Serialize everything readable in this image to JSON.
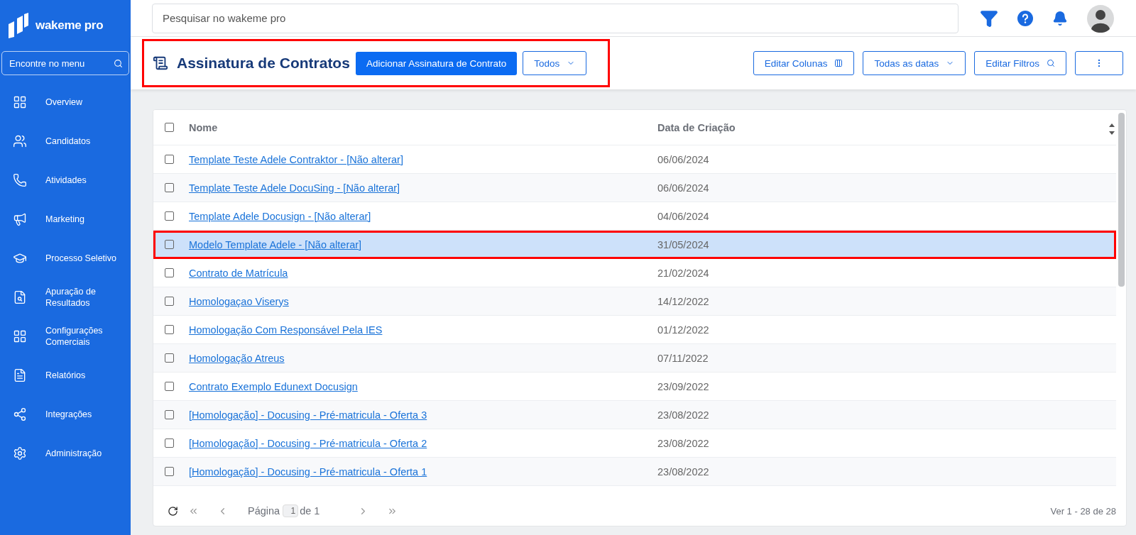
{
  "brand": {
    "name": "wakeme pro"
  },
  "sidebar": {
    "search": {
      "placeholder": "Encontre no menu"
    },
    "items": [
      {
        "label": "Overview",
        "selected": false
      },
      {
        "label": "Candidatos",
        "selected": false
      },
      {
        "label": "Atividades",
        "selected": false
      },
      {
        "label": "Marketing",
        "selected": false
      },
      {
        "label": "Processo Seletivo",
        "selected": false
      },
      {
        "label": "Apuração de Resultados",
        "selected": false
      },
      {
        "label": "Configurações Comerciais",
        "selected": false
      },
      {
        "label": "Relatórios",
        "selected": false
      },
      {
        "label": "Integrações",
        "selected": false
      },
      {
        "label": "Administração",
        "selected": false
      }
    ]
  },
  "topbar": {
    "search": {
      "placeholder": "Pesquisar no wakeme pro"
    }
  },
  "header": {
    "title": "Assinatura de Contratos",
    "add_button": "Adicionar Assinatura de Contrato",
    "filter_dropdown": "Todos",
    "annotated": true,
    "actions": [
      {
        "label": "Editar Colunas",
        "kind": "columns"
      },
      {
        "label": "Todas as datas",
        "kind": "dropdown"
      },
      {
        "label": "Editar Filtros",
        "kind": "search"
      },
      {
        "kind": "more"
      }
    ]
  },
  "table": {
    "columns": [
      "Nome",
      "Data de Criação"
    ],
    "all_checked": false,
    "rows": [
      {
        "name": "Template Teste Adele Contraktor - [Não alterar]",
        "date": "06/06/2024",
        "checked": false,
        "selected": false,
        "annotated": false
      },
      {
        "name": "Template Teste Adele DocuSing - [Não alterar]",
        "date": "06/06/2024",
        "checked": false,
        "selected": false,
        "annotated": false
      },
      {
        "name": "Template Adele Docusign - [Não alterar]",
        "date": "04/06/2024",
        "checked": false,
        "selected": false,
        "annotated": false
      },
      {
        "name": "Modelo Template Adele - [Não alterar]",
        "date": "31/05/2024",
        "checked": false,
        "selected": true,
        "annotated": true
      },
      {
        "name": "Contrato de Matrícula",
        "date": "21/02/2024",
        "checked": false,
        "selected": false,
        "annotated": false
      },
      {
        "name": "Homologaçao Viserys",
        "date": "14/12/2022",
        "checked": false,
        "selected": false,
        "annotated": false
      },
      {
        "name": "Homologação Com Responsável Pela IES",
        "date": "01/12/2022",
        "checked": false,
        "selected": false,
        "annotated": false
      },
      {
        "name": "Homologação Atreus",
        "date": "07/11/2022",
        "checked": false,
        "selected": false,
        "annotated": false
      },
      {
        "name": "Contrato Exemplo Edunext Docusign",
        "date": "23/09/2022",
        "checked": false,
        "selected": false,
        "annotated": false
      },
      {
        "name": "[Homologação] - Docusing - Pré-matricula - Oferta 3",
        "date": "23/08/2022",
        "checked": false,
        "selected": false,
        "annotated": false
      },
      {
        "name": "[Homologação] - Docusing - Pré-matricula - Oferta 2",
        "date": "23/08/2022",
        "checked": false,
        "selected": false,
        "annotated": false
      },
      {
        "name": "[Homologação] - Docusing - Pré-matricula - Oferta 1",
        "date": "23/08/2022",
        "checked": false,
        "selected": false,
        "annotated": false
      }
    ]
  },
  "pagination": {
    "page_label": "Página",
    "page": "1",
    "of_label": "de 1",
    "summary": "Ver 1 - 28 de 28"
  }
}
